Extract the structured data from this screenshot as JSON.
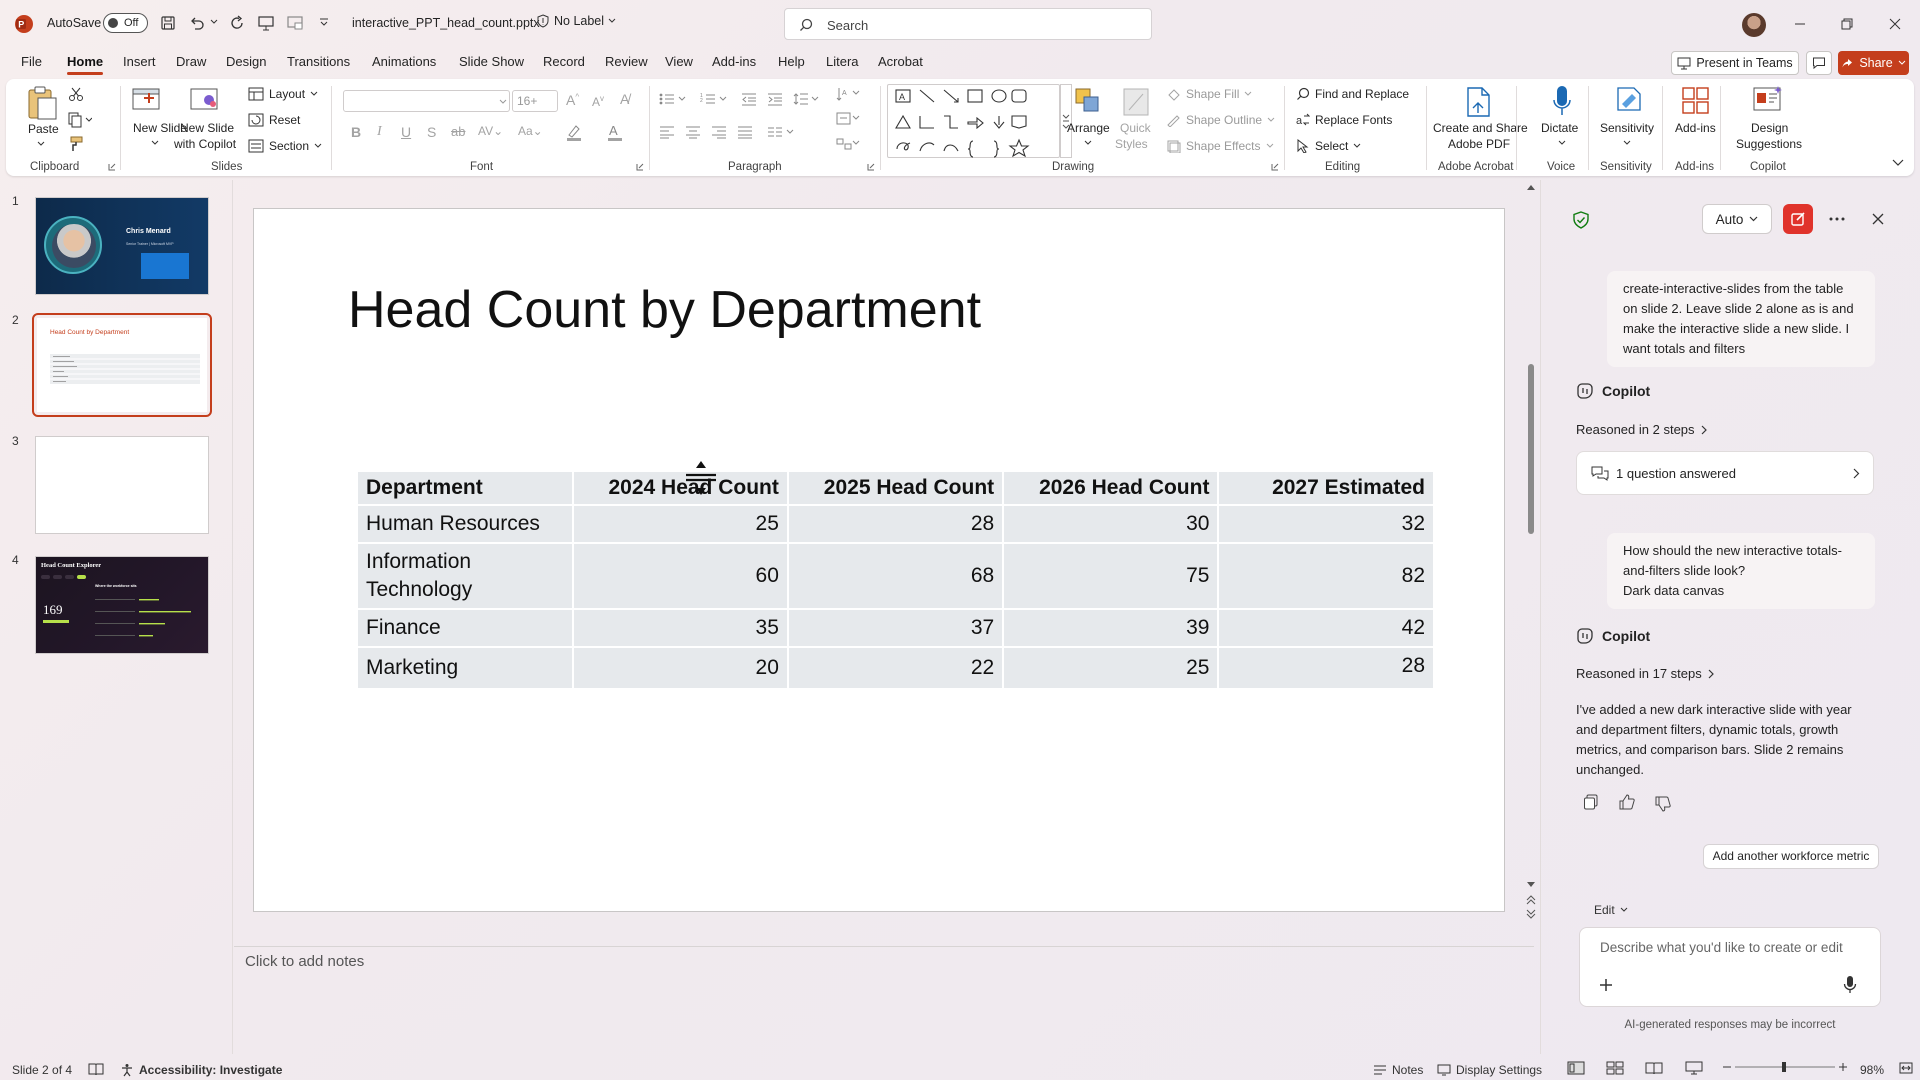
{
  "titlebar": {
    "autosave_label": "AutoSave",
    "autosave_state": "Off",
    "filename": "interactive_PPT_head_count.pptx",
    "sensitivity_label": "No Label",
    "search_placeholder": "Search"
  },
  "menu": {
    "items": [
      "File",
      "Home",
      "Insert",
      "Draw",
      "Design",
      "Transitions",
      "Animations",
      "Slide Show",
      "Record",
      "Review",
      "View",
      "Add-ins",
      "Help",
      "Litera",
      "Acrobat"
    ],
    "active": "Home",
    "present_label": "Present in Teams",
    "share_label": "Share"
  },
  "ribbon": {
    "clipboard": {
      "paste": "Paste",
      "group": "Clipboard"
    },
    "slides": {
      "new_slide": "New Slide",
      "new_slide_copilot_1": "New Slide",
      "new_slide_copilot_2": "with Copilot",
      "layout": "Layout",
      "reset": "Reset",
      "section": "Section",
      "group": "Slides"
    },
    "font": {
      "size": "16+",
      "group": "Font"
    },
    "paragraph": {
      "group": "Paragraph"
    },
    "drawing": {
      "arrange": "Arrange",
      "quick_styles_1": "Quick",
      "quick_styles_2": "Styles",
      "shape_fill": "Shape Fill",
      "shape_outline": "Shape Outline",
      "shape_effects": "Shape Effects",
      "group": "Drawing"
    },
    "editing": {
      "find_replace": "Find and Replace",
      "replace_fonts": "Replace Fonts",
      "select": "Select",
      "group": "Editing"
    },
    "acrobat": {
      "label_1": "Create and Share",
      "label_2": "Adobe PDF",
      "group": "Adobe Acrobat"
    },
    "voice": {
      "label": "Dictate",
      "group": "Voice"
    },
    "sensitivity": {
      "label": "Sensitivity",
      "group": "Sensitivity"
    },
    "addins": {
      "label": "Add-ins",
      "group": "Add-ins"
    },
    "copilot": {
      "label_1": "Design",
      "label_2": "Suggestions",
      "group": "Copilot"
    }
  },
  "thumbnails": {
    "numbers": [
      "1",
      "2",
      "3",
      "4"
    ],
    "slide1_name": "Chris Menard",
    "slide1_sub": "Senior Trainer | Microsoft MVP",
    "slide2_title": "Head Count by Department",
    "slide4_title": "Head Count Explorer",
    "slide4_sub": "Where the workforce sits",
    "slide4_total": "169"
  },
  "slide": {
    "title": "Head Count by Department",
    "columns": [
      "Department",
      "2024 Head Count",
      "2025 Head Count",
      "2026 Head Count",
      "2027 Estimated"
    ],
    "rows": [
      [
        "Human Resources",
        "25",
        "28",
        "30",
        "32"
      ],
      [
        "Information Technology",
        "60",
        "68",
        "75",
        "82"
      ],
      [
        "Finance",
        "35",
        "37",
        "39",
        "42"
      ],
      [
        "Marketing",
        "20",
        "22",
        "25",
        "28"
      ]
    ],
    "notes_placeholder": "Click to add notes"
  },
  "copilot": {
    "mode": "Auto",
    "user_msg_1": "create-interactive-slides from the table on slide 2. Leave slide 2 alone as is and make the interactive slide a new slide. I want totals and filters",
    "name": "Copilot",
    "reasoned_1": "Reasoned in 2 steps",
    "questions_answered": "1 question answered",
    "user_msg_2_line1": "How should the new interactive totals-and-filters slide look?",
    "user_msg_2_line2": "Dark data canvas",
    "reasoned_2": "Reasoned in 17 steps",
    "answer": "I've added a new dark interactive slide with year and department filters, dynamic totals, growth metrics, and comparison bars. Slide 2 remains unchanged.",
    "suggestion": "Add another workforce metric",
    "edit_mode": "Edit",
    "input_placeholder": "Describe what you'd like to create or edit",
    "disclaimer": "AI-generated responses may be incorrect"
  },
  "statusbar": {
    "slide_count": "Slide 2 of 4",
    "accessibility": "Accessibility: Investigate",
    "notes": "Notes",
    "display_settings": "Display Settings",
    "zoom": "98%"
  },
  "colors": {
    "accent": "#c43e1c",
    "copilot_red": "#e0332b"
  }
}
